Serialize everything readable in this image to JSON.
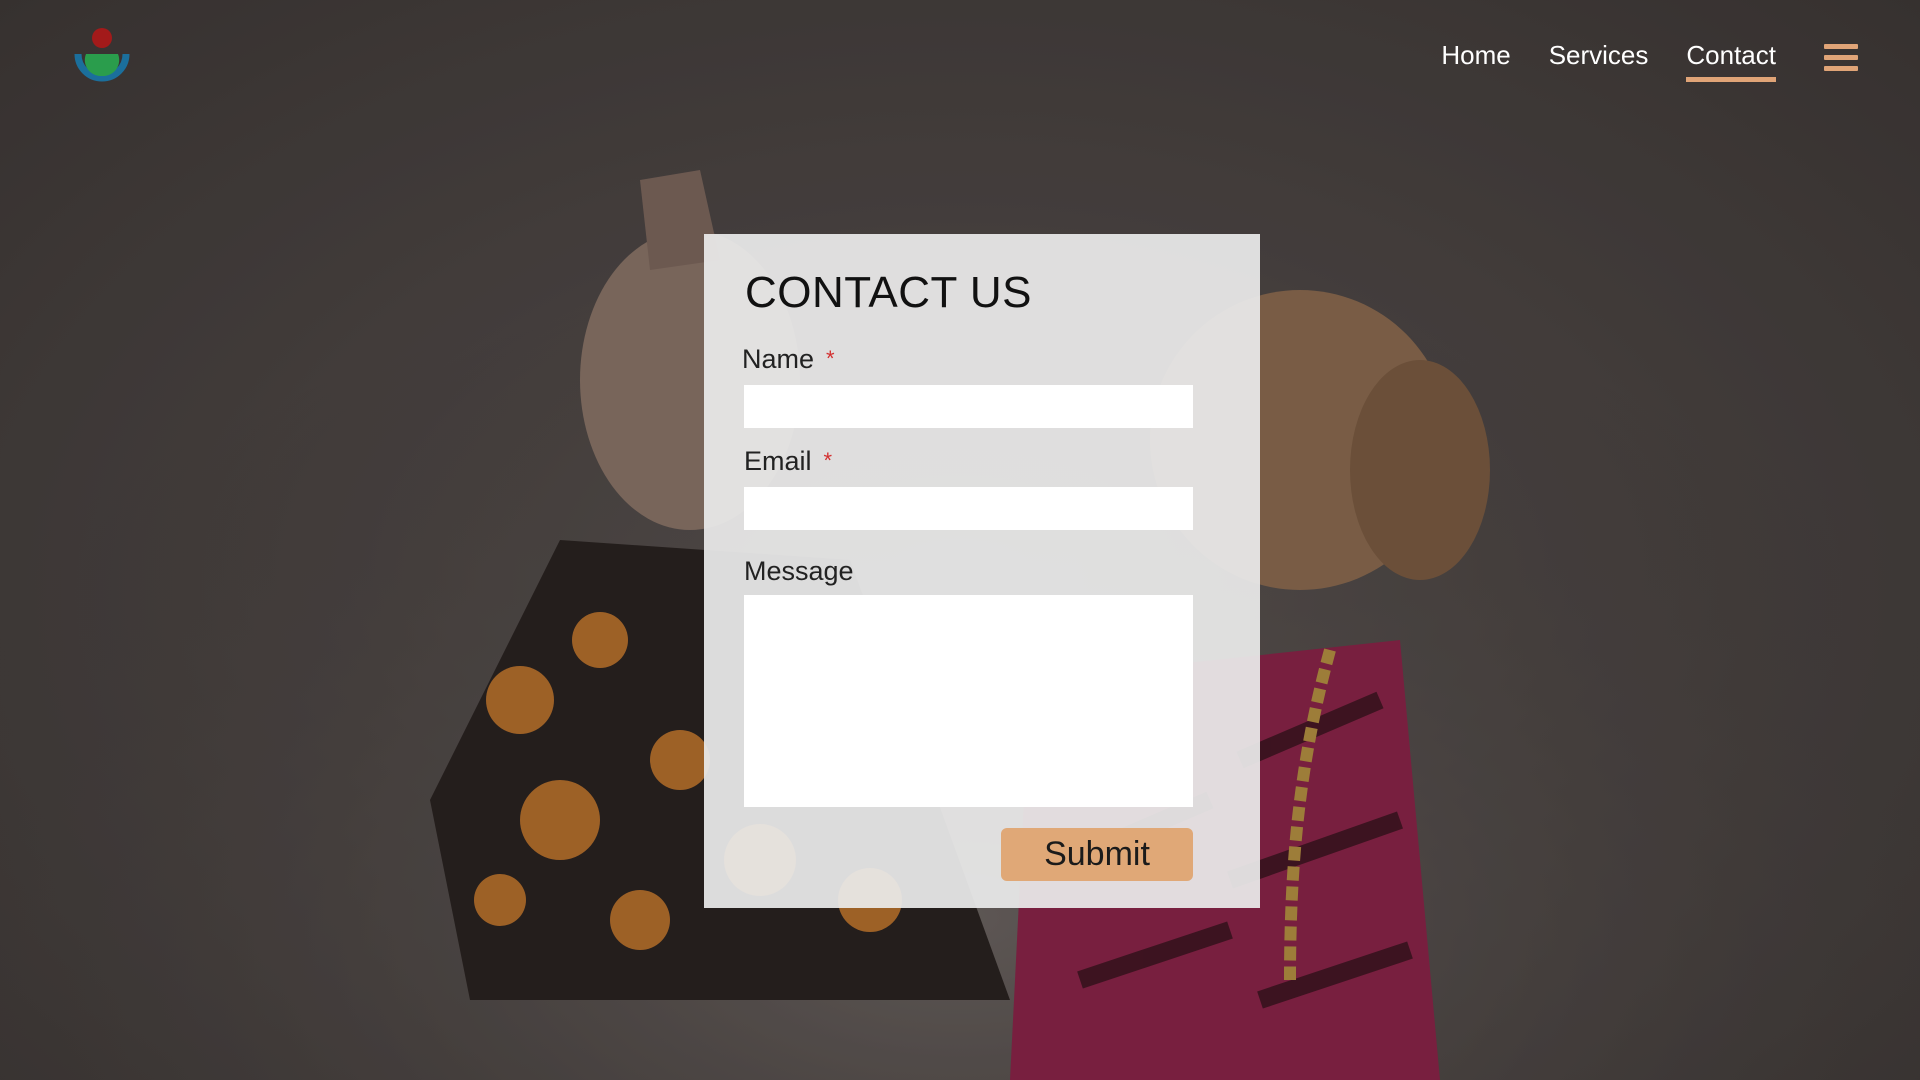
{
  "nav": {
    "items": [
      {
        "label": "Home",
        "active": false
      },
      {
        "label": "Services",
        "active": false
      },
      {
        "label": "Contact",
        "active": true
      }
    ],
    "accent_color": "#e0a477"
  },
  "logo": {
    "icon": "wikimedia-logo-icon"
  },
  "menu": {
    "icon": "hamburger-menu-icon"
  },
  "form": {
    "title": "CONTACT US",
    "fields": {
      "name": {
        "label": "Name",
        "required_mark": "*",
        "value": ""
      },
      "email": {
        "label": "Email",
        "required_mark": "*",
        "value": ""
      },
      "message": {
        "label": "Message",
        "value": ""
      }
    },
    "submit_label": "Submit",
    "submit_color": "#e0a877"
  }
}
